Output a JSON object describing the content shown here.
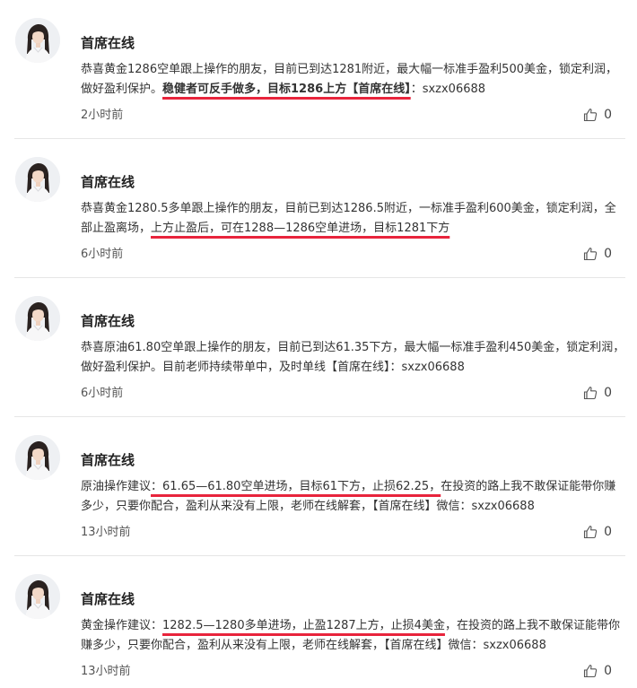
{
  "posts": [
    {
      "author": "首席在线",
      "segments": [
        {
          "text": "恭喜黄金1286空单跟上操作的朋友，目前已到达1281附近，最大幅一标准手盈利500美金，锁定利润，做好盈利保护。",
          "hl": false,
          "bold": false
        },
        {
          "text": "稳健者可反手做多，目标1286上方【首席在线】",
          "hl": true,
          "bold": true
        },
        {
          "text": "：sxzx06688",
          "hl": false,
          "bold": false
        }
      ],
      "time": "2小时前",
      "likes": "0"
    },
    {
      "author": "首席在线",
      "segments": [
        {
          "text": "恭喜黄金1280.5多单跟上操作的朋友，目前已到达1286.5附近，一标准手盈利600美金，锁定利润，全部止盈离场，",
          "hl": false,
          "bold": false
        },
        {
          "text": "上方止盈后，可在1288—1286空单进场，目标1281下方",
          "hl": true,
          "bold": false
        }
      ],
      "time": "6小时前",
      "likes": "0"
    },
    {
      "author": "首席在线",
      "segments": [
        {
          "text": "恭喜原油61.80空单跟上操作的朋友，目前已到达61.35下方，最大幅一标准手盈利450美金，锁定利润，做好盈利保护。目前老师持续带单中，及时单线【首席在线】：sxzx06688",
          "hl": false,
          "bold": false
        }
      ],
      "time": "6小时前",
      "likes": "0"
    },
    {
      "author": "首席在线",
      "segments": [
        {
          "text": "原油操作建议",
          "hl": false,
          "bold": false
        },
        {
          "text": "：61.65—61.80空单进场，目标61下方，止损62.25，",
          "hl": true,
          "bold": false
        },
        {
          "text": "在投资的路上我不敢保证能带你赚多少，只要你配合，盈利从来没有上限，老师在线解套，【首席在线】微信：sxzx06688",
          "hl": false,
          "bold": false
        }
      ],
      "time": "13小时前",
      "likes": "0"
    },
    {
      "author": "首席在线",
      "segments": [
        {
          "text": "黄金操作建议：",
          "hl": false,
          "bold": false
        },
        {
          "text": "1282.5—1280多单进场，止盈1287上方，止损4美金",
          "hl": true,
          "bold": false
        },
        {
          "text": "，在投资的路上我不敢保证能带你赚多少，只要你配合，盈利从来没有上限，老师在线解套，【首席在线】微信：sxzx06688",
          "hl": false,
          "bold": false
        }
      ],
      "time": "13小时前",
      "likes": "0"
    }
  ],
  "icons": {
    "avatar": "user-avatar-photo",
    "like": "thumbs-up-icon"
  },
  "colors": {
    "underline": "#e8243c",
    "divider": "#e6e6e6",
    "text": "#333333"
  }
}
